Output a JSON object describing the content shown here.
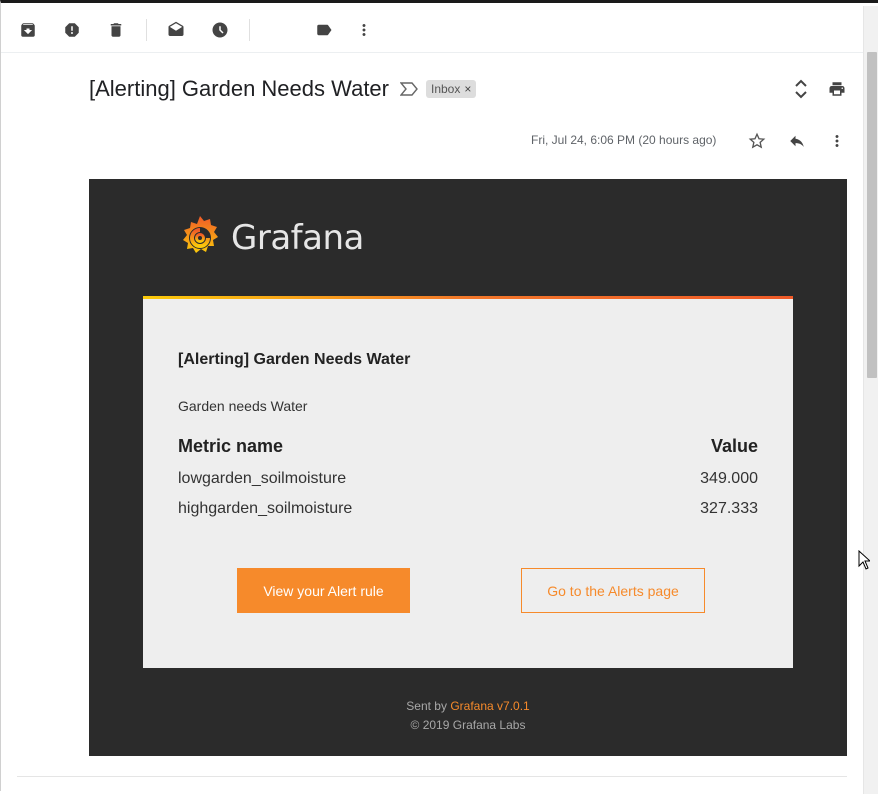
{
  "toolbar": {
    "icons": [
      "archive-icon",
      "report-spam-icon",
      "delete-icon",
      "mark-unread-icon",
      "snooze-icon",
      "label-icon",
      "more-vert-icon"
    ]
  },
  "message": {
    "subject": "[Alerting] Garden Needs Water",
    "label": "Inbox",
    "label_remove": "×",
    "date": "Fri, Jul 24, 6:06 PM (20 hours ago)"
  },
  "email": {
    "brand": "Grafana",
    "card_title": "[Alerting] Garden Needs Water",
    "card_message": "Garden needs Water",
    "table": {
      "headers": [
        "Metric name",
        "Value"
      ],
      "rows": [
        {
          "metric": "lowgarden_soilmoisture",
          "value": "349.000"
        },
        {
          "metric": "highgarden_soilmoisture",
          "value": "327.333"
        }
      ]
    },
    "primary_button": "View your Alert rule",
    "secondary_button": "Go to the Alerts page",
    "footer": {
      "sent_by": "Sent by",
      "sender_link": "Grafana v7.0.1",
      "copyright": "© 2019 Grafana Labs"
    }
  },
  "colors": {
    "accent": "#f68a2b",
    "email_bg": "#2b2b2b",
    "card_bg": "#eeeeee"
  }
}
